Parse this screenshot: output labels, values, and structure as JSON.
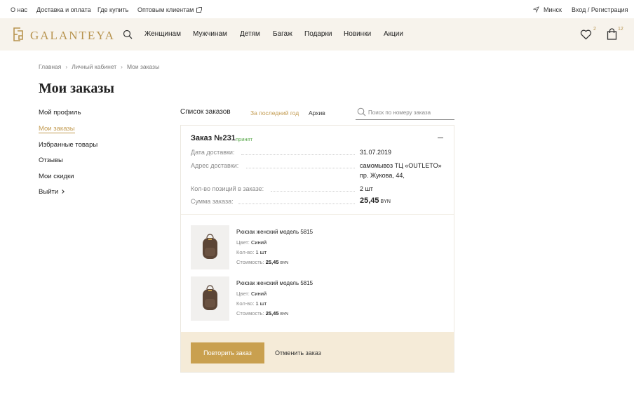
{
  "topbar": {
    "links": [
      "О нас",
      "Доставка и оплата",
      "Где купить",
      "Оптовым клиентам"
    ],
    "city": "Минск",
    "login": "Вход / Регистрация"
  },
  "header": {
    "logo_text": "GALANTEYA",
    "nav": [
      "Женщинам",
      "Мужчинам",
      "Детям",
      "Багаж",
      "Подарки",
      "Новинки",
      "Акции"
    ],
    "wishlist_count": "2",
    "cart_count": "12"
  },
  "breadcrumbs": [
    "Главная",
    "Личный кабинет",
    "Мои заказы"
  ],
  "page_title": "Мои заказы",
  "sidebar": {
    "items": [
      "Мой профиль",
      "Мои заказы",
      "Избранные товары",
      "Отзывы",
      "Мои скидки",
      "Выйти"
    ],
    "active": "Мои заказы"
  },
  "orders": {
    "title": "Список заказов",
    "filter_year": "За последний год",
    "filter_archive": "Архив",
    "search_placeholder": "Поиск по номеру заказа"
  },
  "order": {
    "number": "Заказ №231",
    "status": "принят",
    "rows": {
      "date_label": "Дата доставки:",
      "date_value": "31.07.2019",
      "address_label": "Адрес доставки:",
      "address_line1": "самомывоз ТЦ «OUTLETO»",
      "address_line2": "пр. Жукова, 44,",
      "count_label": "Кол-во позиций в заказе:",
      "count_value": "2 шт",
      "sum_label": "Сумма заказа:",
      "sum_value": "25,45",
      "sum_currency": "BYN"
    },
    "items": [
      {
        "name": "Рюкзак женский модель 5815",
        "color_label": "Цвет:",
        "color_value": "Синий",
        "qty_label": "Кол-во:",
        "qty_value": "1 шт",
        "price_label": "Стоимость:",
        "price_value": "25,45",
        "price_currency": "BYN"
      },
      {
        "name": "Рюкзак женский модель 5815",
        "color_label": "Цвет:",
        "color_value": "Синий",
        "qty_label": "Кол-во:",
        "qty_value": "1 шт",
        "price_label": "Стоимость:",
        "price_value": "25,45",
        "price_currency": "BYN"
      }
    ],
    "repeat_button": "Повторить заказ",
    "cancel_button": "Отменить заказ"
  },
  "colors": {
    "accent": "#c9a04f",
    "header_bg": "#f7f3ec",
    "footer_bg": "#f5ebd8",
    "status": "#58a84a"
  },
  "icons": [
    "location-icon",
    "external-link-icon",
    "logo-mark-icon",
    "search-icon",
    "heart-icon",
    "bag-icon",
    "collapse-icon",
    "chevron-right-icon",
    "backpack-icon"
  ]
}
